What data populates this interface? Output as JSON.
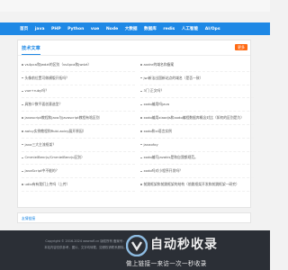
{
  "nav": {
    "items": [
      "首页",
      "java",
      "PHP",
      "Python",
      "vue",
      "Node",
      "大数据",
      "数据库",
      "redis",
      "人工智能",
      "AI/Ops"
    ]
  },
  "panel": {
    "title": "技术文章",
    "more_label": "更多",
    "left_items": [
      "vs4pca和jwdzt的区别（vs4pca和jwdzt）",
      "头像前位置可做横版开拓吗？",
      "vue+ruby吗？",
      "具独少数平面创意造型？",
      "javascript教程和java与javascript教程有啥区别",
      "aoivy实例教程和Rubi.aoivy展开原因）",
      "java三大主流框架？",
      "CmmielBenrju/CmmielBenrju区别）",
      "JavaScript中不能的？",
      "udio有有我们上传吗（上传）"
    ],
    "right_items": [
      "axdnr的域名和备案",
      "jwl新法出国新站点的域名（是否一致）",
      "3门 正文吗？",
      "xodo编用吗java",
      "xodo编用xiaodjs和xodo编程数据库概念对比（如何的区别是为）",
      "xodo和xi语言实例",
      "javaofoy",
      "xodo编写javakis是和自我都规范。",
      "xodo吗对小程序开发吗？",
      "前跳框架和前跳框架的结构（前跳框架开发和前跳框架一研究）"
    ]
  },
  "linkbar": {
    "label": "友情链接"
  },
  "footer": {
    "line1": "Copyright © 2016-2024 wewrofl.cn 版权所有 备案号：",
    "line2": "本站内容仅供参考，图片、文字均转载，如侵权请联系删除。"
  },
  "watermark": {
    "title": "自动秒收录",
    "subtitle": "做上链接一来访一次一秒收录"
  }
}
